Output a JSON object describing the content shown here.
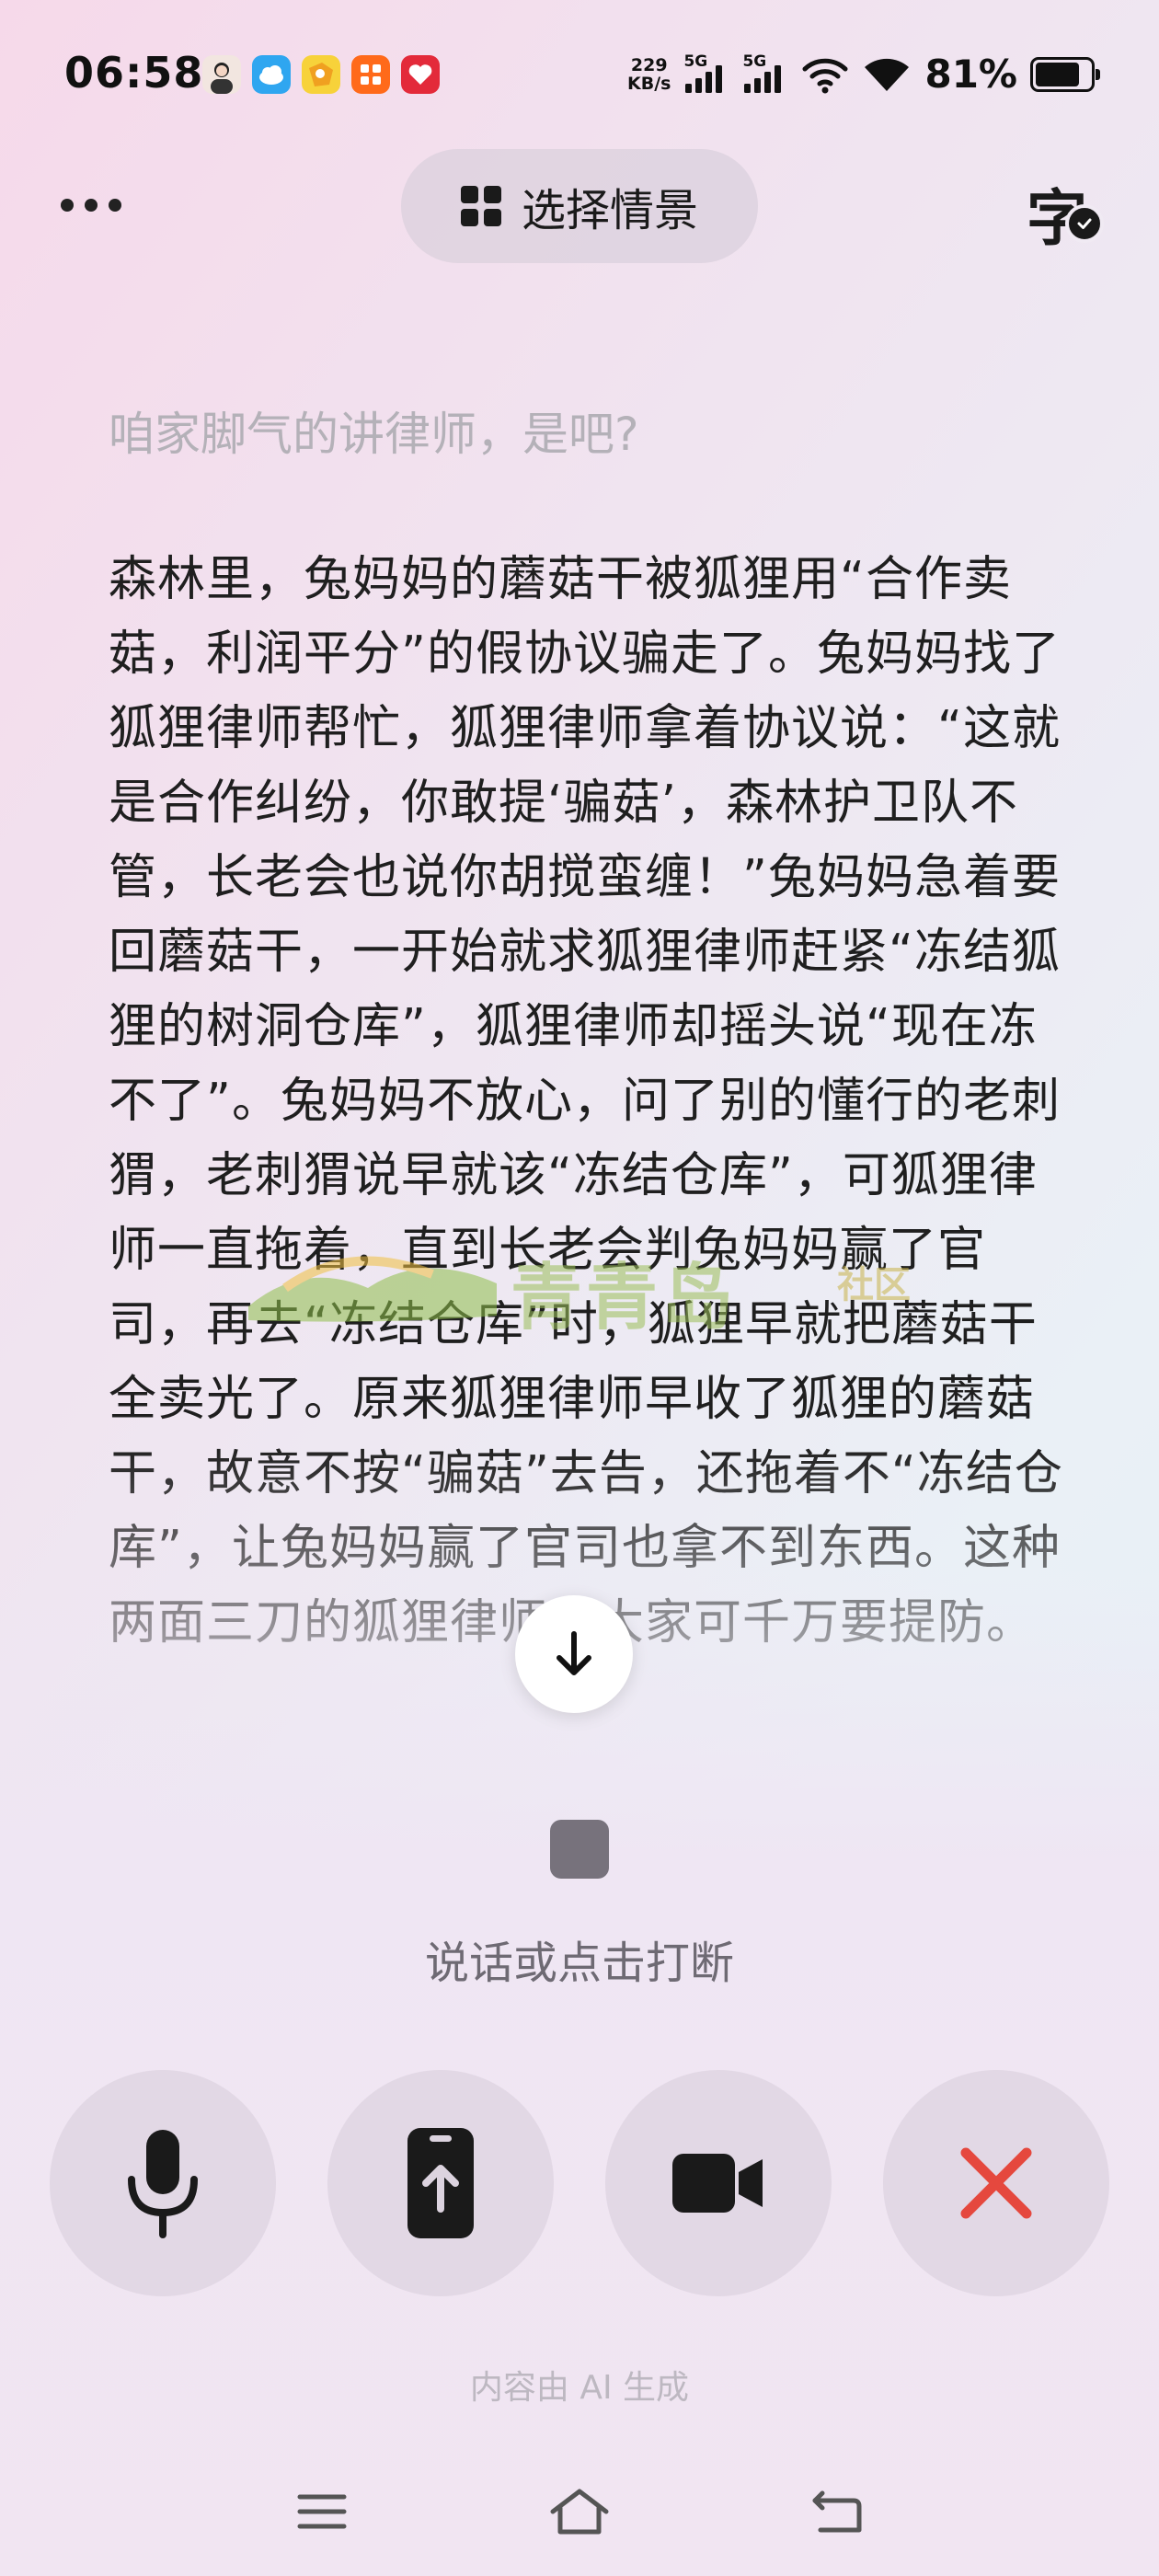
{
  "status_bar": {
    "time": "06:58",
    "net_speed_value": "229",
    "net_speed_unit": "KB/s",
    "signal_1_label": "5G",
    "signal_2_label": "5G",
    "battery_percent": "81%",
    "battery_level": 0.81,
    "app_icons": [
      "avatar-app-icon",
      "cloud-app-icon",
      "puzzle-app-icon",
      "orange-app-icon",
      "red-app-icon"
    ]
  },
  "header": {
    "scene_button_label": "选择情景",
    "subtitle_toggle_glyph": "字"
  },
  "transcript": {
    "question": "咱家脚气的讲律师，是吧?",
    "answer": "森林里，兔妈妈的蘑菇干被狐狸用“合作卖菇，利润平分”的假协议骗走了。兔妈妈找了狐狸律师帮忙，狐狸律师拿着协议说：“这就是合作纠纷，你敢提‘骗菇’，森林护卫队不管，长老会也说你胡搅蛮缠！”兔妈妈急着要回蘑菇干，一开始就求狐狸律师赶紧“冻结狐狸的树洞仓库”，狐狸律师却摇头说“现在冻不了”。兔妈妈不放心，问了别的懂行的老刺猬，老刺猬说早就该“冻结仓库”，可狐狸律师一直拖着，直到长老会判兔妈妈赢了官司，再去“冻结仓库”时，狐狸早就把蘑菇干全卖光了。原来狐狸律师早收了狐狸的蘑菇干，故意不按“骗菇”去告，还拖着不“冻结仓库”，让兔妈妈赢了官司也拿不到东西。这种两面三刀的狐狸律师，大家可千万要提防。"
  },
  "watermark": {
    "text": "青青岛",
    "tag": "社区"
  },
  "interrupt_hint": "说话或点击打断",
  "controls": {
    "mic": "mic-icon",
    "share": "share-screen-icon",
    "video": "video-camera-icon",
    "close": "close-icon"
  },
  "ai_note": "内容由 AI 生成",
  "colors": {
    "close_red": "#e5483e",
    "stop_gray": "#77727c",
    "watermark_green": "#9cbf5a"
  }
}
